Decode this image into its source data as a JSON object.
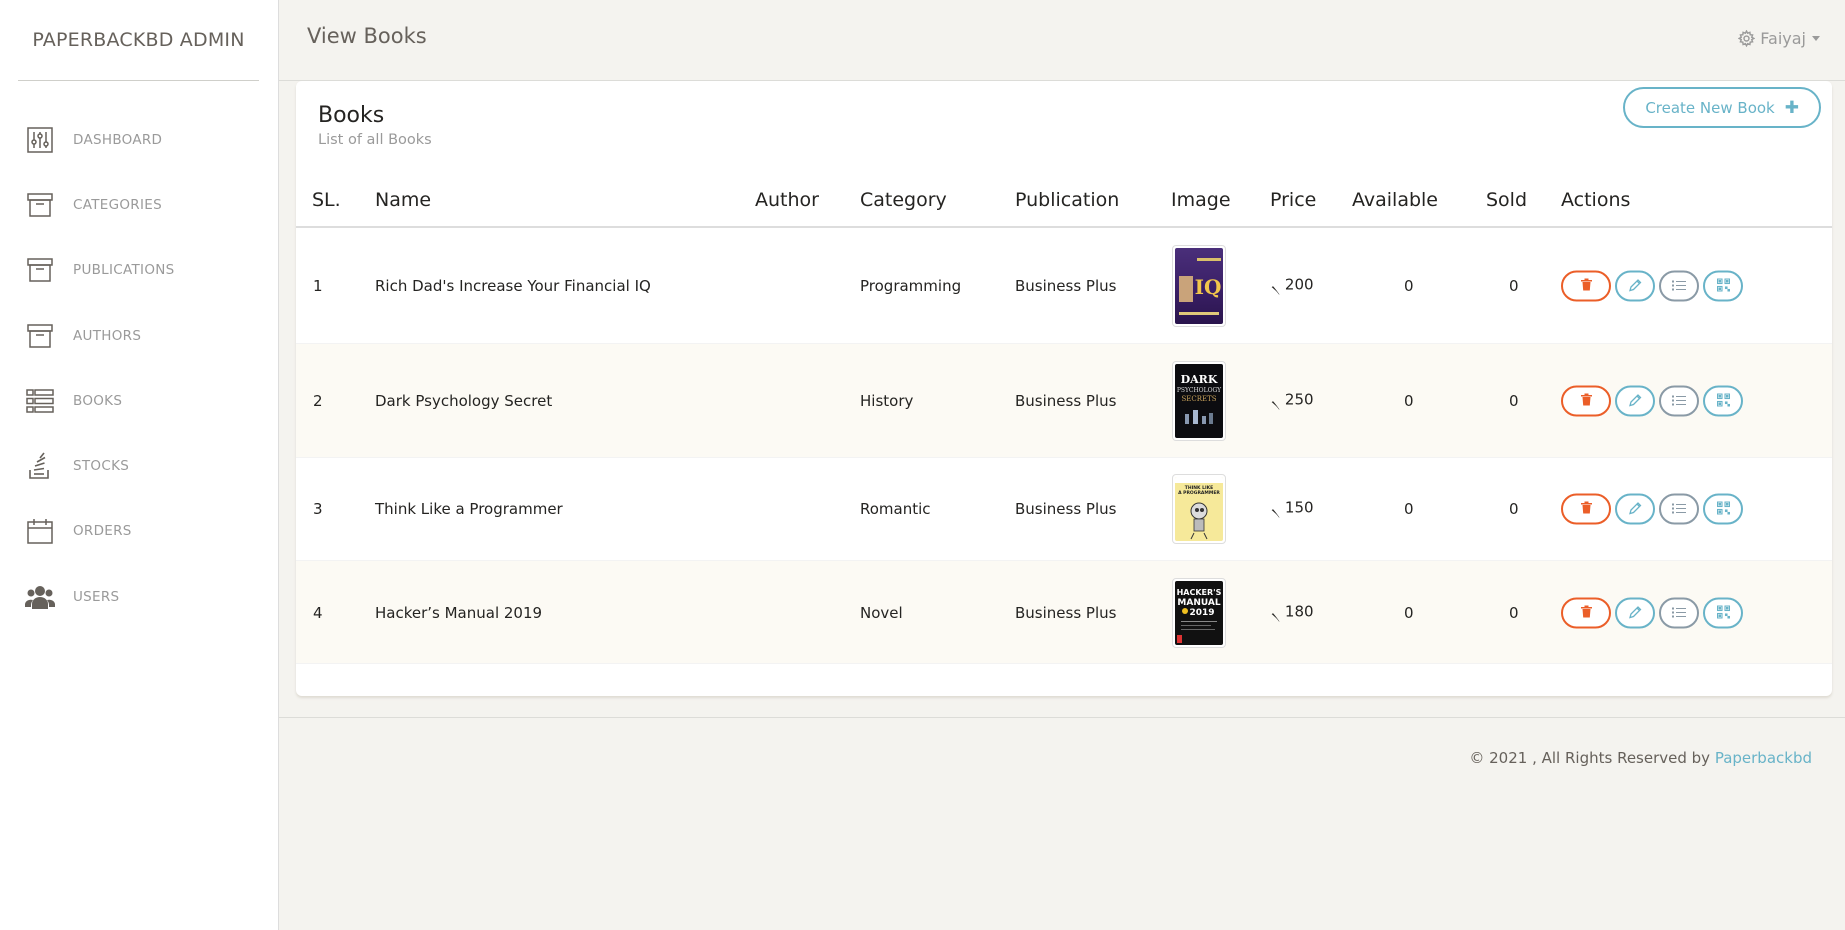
{
  "sidebar": {
    "brand": "PAPERBACKBD ADMIN",
    "items": [
      {
        "label": "DASHBOARD",
        "icon": "sliders-icon"
      },
      {
        "label": "CATEGORIES",
        "icon": "archive-icon"
      },
      {
        "label": "PUBLICATIONS",
        "icon": "archive-icon"
      },
      {
        "label": "AUTHORS",
        "icon": "archive-icon"
      },
      {
        "label": "BOOKS",
        "icon": "list-icon"
      },
      {
        "label": "STOCKS",
        "icon": "stack-icon"
      },
      {
        "label": "ORDERS",
        "icon": "calendar-icon"
      },
      {
        "label": "USERS",
        "icon": "users-icon"
      }
    ]
  },
  "header": {
    "title": "View Books",
    "user_name": "Faiyaj"
  },
  "card": {
    "title": "Books",
    "subtitle": "List of all Books",
    "create_label": "Create New Book"
  },
  "table": {
    "columns": [
      "SL.",
      "Name",
      "Author",
      "Category",
      "Publication",
      "Image",
      "Price",
      "Available",
      "Sold",
      "Actions"
    ],
    "rows": [
      {
        "sl": "1",
        "name": "Rich Dad's Increase Your Financial IQ",
        "author": "",
        "category": "Programming",
        "publication": "Business Plus",
        "cover": "Rich Dad IQ cover",
        "price": "৲ 200",
        "available": "0",
        "sold": "0"
      },
      {
        "sl": "2",
        "name": "Dark Psychology Secret",
        "author": "",
        "category": "History",
        "publication": "Business Plus",
        "cover": "Dark Psychology Secrets cover",
        "price": "৲ 250",
        "available": "0",
        "sold": "0"
      },
      {
        "sl": "3",
        "name": "Think Like a Programmer",
        "author": "",
        "category": "Romantic",
        "publication": "Business Plus",
        "cover": "Think Like a Programmer cover",
        "price": "৲ 150",
        "available": "0",
        "sold": "0"
      },
      {
        "sl": "4",
        "name": "Hacker’s Manual 2019",
        "author": "",
        "category": "Novel",
        "publication": "Business Plus",
        "cover": "Hacker's Manual 2019 cover",
        "price": "৲ 180",
        "available": "0",
        "sold": "0"
      }
    ]
  },
  "footer": {
    "text": "© 2021 , All Rights Reserved by ",
    "link": "Paperbackbd"
  },
  "colors": {
    "info": "#68b3c8",
    "danger": "#eb5e28",
    "text": "#66615b",
    "muted": "#9a9a9a",
    "background": "#f4f3ef",
    "stripe": "#fcfaf4"
  }
}
